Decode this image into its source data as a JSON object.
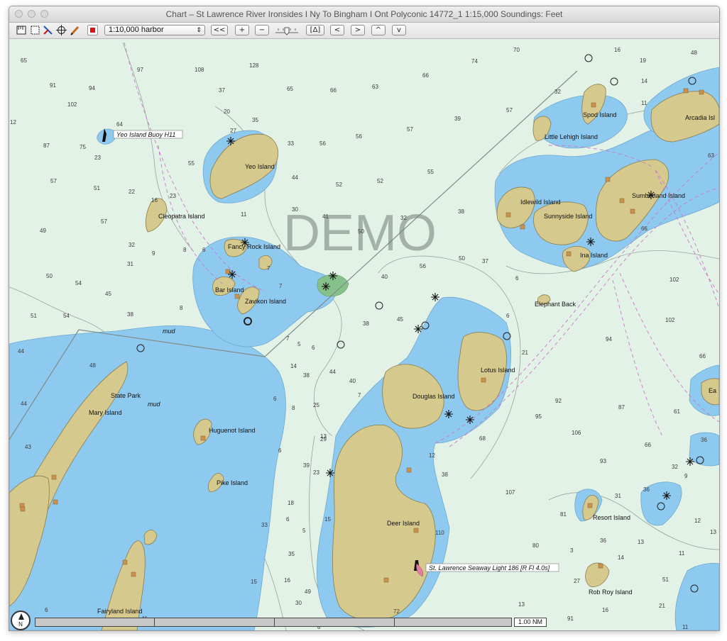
{
  "window": {
    "title": "Chart – St Lawrence River Ironsides I Ny To Bingham I Ont Polyconic 14772_1 1:15,000  Soundings: Feet"
  },
  "toolbar": {
    "scale_select": "1:10,000 harbor",
    "buttons": {
      "prev": "<<",
      "zoom_in": "+",
      "zoom_out": "−",
      "tri": "[Δ]",
      "left": "<",
      "right": ">",
      "up": "^",
      "down": "v"
    }
  },
  "watermark": "DEMO",
  "places": [
    {
      "name": "Yeo Island Buoy H11",
      "id": "buoy-h11",
      "boxed": true
    },
    {
      "name": "Yeo Island",
      "id": "yeo"
    },
    {
      "name": "Cleopatra Island",
      "id": "cleopatra"
    },
    {
      "name": "Fancy Rock Island",
      "id": "fancy-rock"
    },
    {
      "name": "Bar Island",
      "id": "bar"
    },
    {
      "name": "Zavikon Island",
      "id": "zavikon"
    },
    {
      "name": "State Park",
      "id": "state-park"
    },
    {
      "name": "Mary Island",
      "id": "mary"
    },
    {
      "name": "Huguenot Island",
      "id": "huguenot"
    },
    {
      "name": "Pike Island",
      "id": "pike"
    },
    {
      "name": "Fairyland Island",
      "id": "fairyland"
    },
    {
      "name": "Douglas Island",
      "id": "douglas"
    },
    {
      "name": "Lotus Island",
      "id": "lotus"
    },
    {
      "name": "Deer Island",
      "id": "deer"
    },
    {
      "name": "St. Lawrence Seaway Light 186 [R Fl 4.0s]",
      "id": "seaway-light",
      "boxed": true
    },
    {
      "name": "Spod Island",
      "id": "spod"
    },
    {
      "name": "Little Lehigh Island",
      "id": "little-lehigh"
    },
    {
      "name": "Arcadia Isl",
      "id": "arcadia"
    },
    {
      "name": "Idlewild Island",
      "id": "idlewild"
    },
    {
      "name": "Sunnyside Island",
      "id": "sunnyside"
    },
    {
      "name": "Sumberland Island",
      "id": "sumberland"
    },
    {
      "name": "Ina Island",
      "id": "ina"
    },
    {
      "name": "Elephant Back",
      "id": "elephant-back"
    },
    {
      "name": "Resort  Island",
      "id": "resort"
    },
    {
      "name": "Rob Roy Island",
      "id": "rob-roy"
    },
    {
      "name": "Ea",
      "id": "ea"
    }
  ],
  "mud_labels": [
    "mud",
    "mud"
  ],
  "soundings": [
    "65",
    "97",
    "108",
    "128",
    "74",
    "70",
    "16",
    "19",
    "48",
    "91",
    "94",
    "37",
    "65",
    "66",
    "63",
    "66",
    "32",
    "14",
    "102",
    "20",
    "35",
    "64",
    "27",
    "33",
    "56",
    "56",
    "57",
    "39",
    "57",
    "11",
    "12",
    "69",
    "66",
    "87",
    "75",
    "23",
    "55",
    "44",
    "52",
    "52",
    "55",
    "38",
    "63",
    "57",
    "51",
    "22",
    "16",
    "23",
    "11",
    "30",
    "41",
    "50",
    "32",
    "49",
    "57",
    "32",
    "9",
    "8",
    "6",
    "7",
    "50",
    "37",
    "66",
    "31",
    "50",
    "54",
    "45",
    "40",
    "56",
    "6",
    "102",
    "51",
    "54",
    "38",
    "8",
    "7",
    "7",
    "5",
    "38",
    "45",
    "6",
    "102",
    "44",
    "48",
    "14",
    "6",
    "38",
    "44",
    "40",
    "21",
    "94",
    "66",
    "44",
    "6",
    "8",
    "25",
    "7",
    "95",
    "92",
    "87",
    "61",
    "43",
    "13",
    "29",
    "6",
    "68",
    "106",
    "66",
    "36",
    "39",
    "23",
    "12",
    "38",
    "93",
    "32",
    "9",
    "18",
    "15",
    "107",
    "31",
    "36",
    "5",
    "81",
    "12",
    "13",
    "33",
    "6",
    "110",
    "80",
    "35",
    "13",
    "14",
    "11",
    "15",
    "16",
    "49",
    "30",
    "3",
    "36",
    "27",
    "51",
    "13",
    "72",
    "91",
    "16",
    "21",
    "11",
    "8",
    "41",
    "6",
    "6"
  ],
  "scale": {
    "label": "1.00 NM"
  },
  "compass": "N",
  "colors": {
    "deep_water": "#e3f2e6",
    "shallow_water": "#8ec9ef",
    "land": "#d6c98e",
    "marsh": "#86c18a",
    "route": "#cc77cc"
  }
}
